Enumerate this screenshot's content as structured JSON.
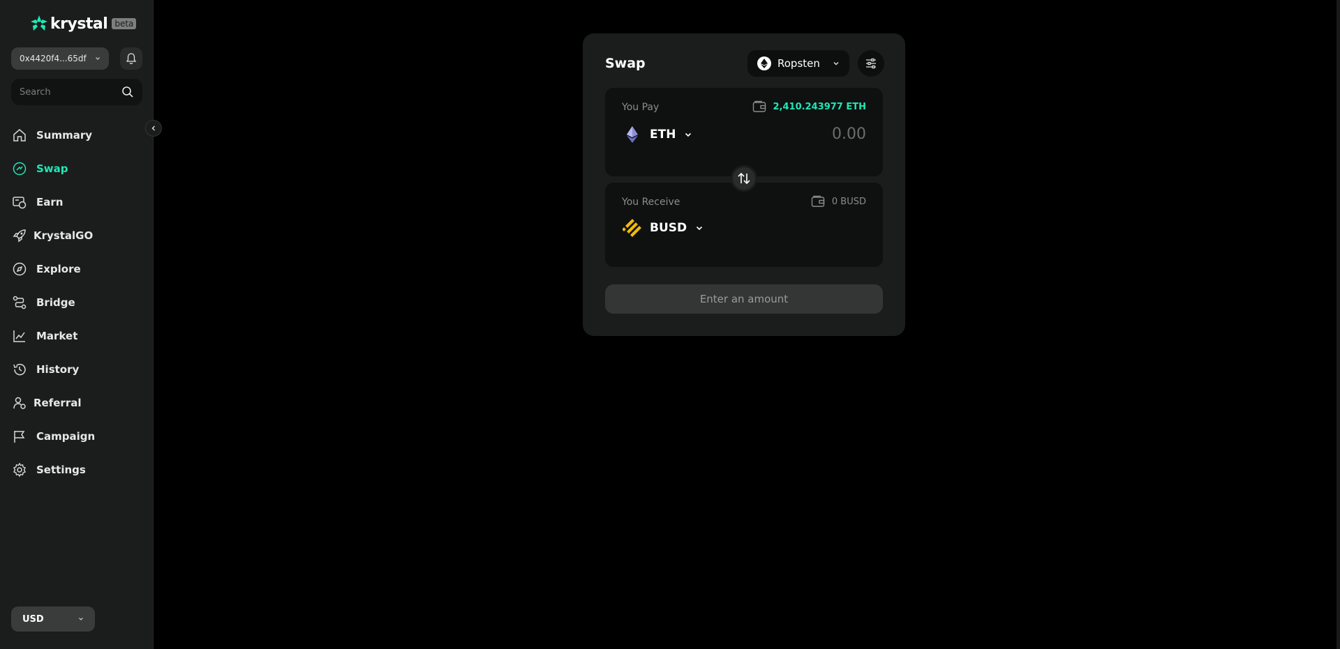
{
  "brand": {
    "name": "krystal",
    "badge": "beta"
  },
  "wallet": {
    "address": "0x4420f4...65df"
  },
  "search": {
    "placeholder": "Search"
  },
  "nav": {
    "items": [
      {
        "label": "Summary",
        "icon": "home-icon",
        "active": false
      },
      {
        "label": "Swap",
        "icon": "swap-icon",
        "active": true
      },
      {
        "label": "Earn",
        "icon": "earn-icon",
        "active": false
      },
      {
        "label": "KrystalGO",
        "icon": "rocket-icon",
        "active": false
      },
      {
        "label": "Explore",
        "icon": "compass-icon",
        "active": false
      },
      {
        "label": "Bridge",
        "icon": "bridge-icon",
        "active": false
      },
      {
        "label": "Market",
        "icon": "chart-icon",
        "active": false
      },
      {
        "label": "History",
        "icon": "history-icon",
        "active": false
      },
      {
        "label": "Referral",
        "icon": "referral-icon",
        "active": false
      },
      {
        "label": "Campaign",
        "icon": "flag-icon",
        "active": false
      },
      {
        "label": "Settings",
        "icon": "gear-icon",
        "active": false
      }
    ]
  },
  "currency": {
    "selected": "USD"
  },
  "swap": {
    "title": "Swap",
    "network": "Ropsten",
    "pay": {
      "label": "You Pay",
      "balance": "2,410.243977 ETH",
      "token": "ETH",
      "amount_placeholder": "0.00"
    },
    "receive": {
      "label": "You Receive",
      "balance": "0 BUSD",
      "token": "BUSD"
    },
    "action_label": "Enter an amount"
  },
  "colors": {
    "accent": "#1de9b6",
    "sidebar_bg": "#1b1d1c",
    "card_bg": "#1b1d1c",
    "panel_bg": "#0f1010",
    "busd": "#f0b90b"
  }
}
